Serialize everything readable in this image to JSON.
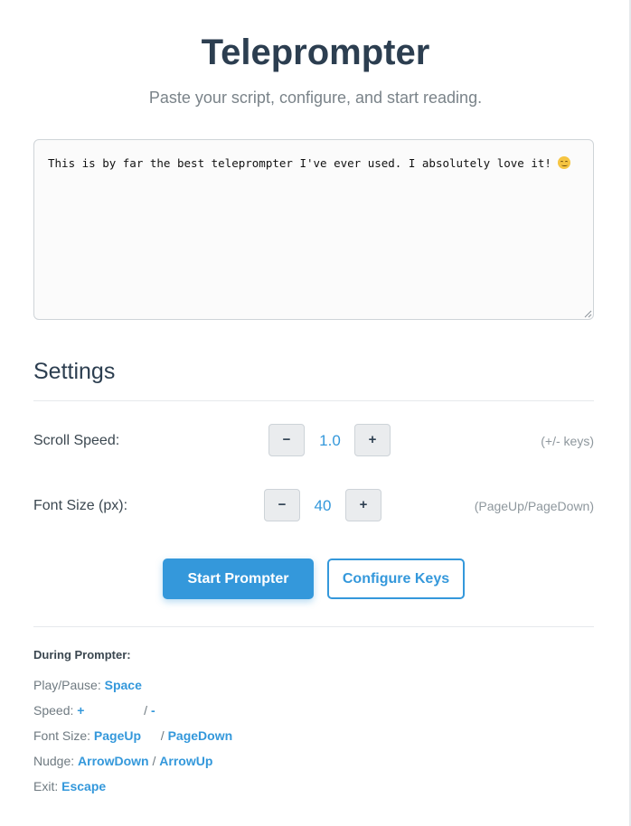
{
  "page": {
    "title": "Teleprompter",
    "subtitle": "Paste your script, configure, and start reading."
  },
  "script": {
    "text": "This is by far the best teleprompter I've ever used. I absolutely love it!",
    "emoji_icon": "smiling-face-icon"
  },
  "settings": {
    "heading": "Settings",
    "scroll_speed": {
      "label": "Scroll Speed:",
      "decrement": "−",
      "value": "1.0",
      "increment": "+",
      "hint": "(+/- keys)"
    },
    "font_size": {
      "label": "Font Size (px):",
      "decrement": "−",
      "value": "40",
      "increment": "+",
      "hint": "(PageUp/PageDown)"
    }
  },
  "actions": {
    "start": "Start Prompter",
    "configure": "Configure Keys"
  },
  "help": {
    "title": "During Prompter:",
    "play_pause": {
      "label": "Play/Pause: ",
      "key": "Space"
    },
    "speed": {
      "label": "Speed: ",
      "key1": "+",
      "sep": " / ",
      "key2": "-"
    },
    "font_size": {
      "label": "Font Size: ",
      "key1": "PageUp",
      "sep": " / ",
      "key2": "PageDown"
    },
    "nudge": {
      "label": "Nudge: ",
      "key1": "ArrowDown",
      "sep": " / ",
      "key2": "ArrowUp"
    },
    "exit": {
      "label": "Exit: ",
      "key": "Escape"
    }
  },
  "colors": {
    "accent": "#3498db",
    "heading": "#2c3e50",
    "muted": "#8e979d"
  }
}
